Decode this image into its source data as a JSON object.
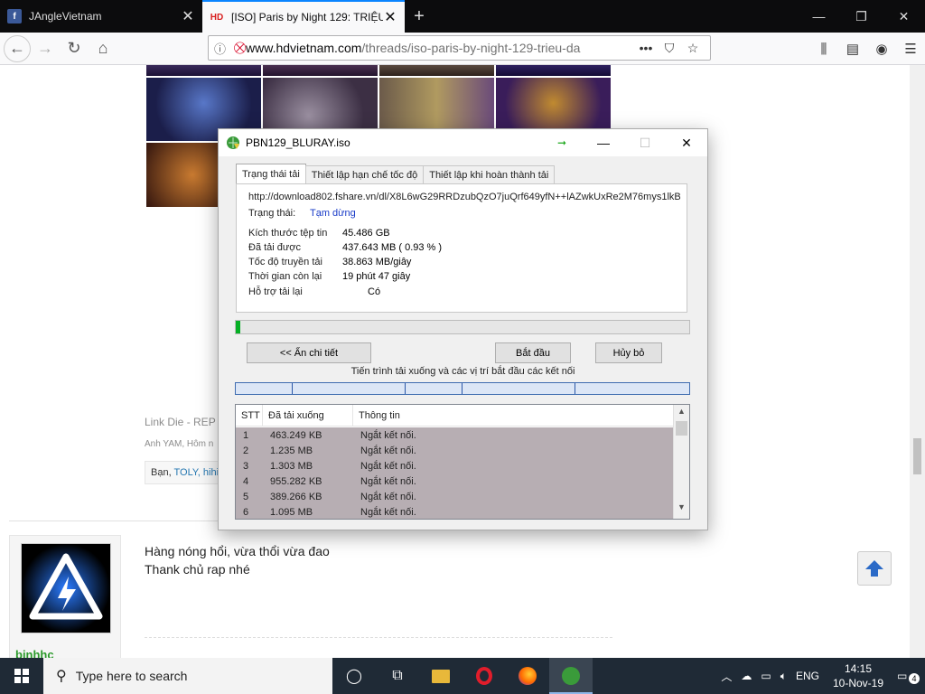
{
  "browser": {
    "tabs": [
      {
        "title": "JAngleVietnam",
        "favicon": "f",
        "active": false
      },
      {
        "title": "[ISO] Paris by Night 129: TRIỆU",
        "favicon": "HD",
        "active": true
      }
    ],
    "url_domain": "www.hdvietnam.com",
    "url_path": "/threads/iso-paris-by-night-129-trieu-da"
  },
  "page": {
    "link_die": "Link Die - REP",
    "anh_yam": "Anh YAM, Hôm n",
    "reactions_prefix": "Bạn, ",
    "reactions_names": "TOLY, hihi",
    "post_line1": "Hàng nóng hổi, vừa thổi vừa đao",
    "post_line2": "Thank chủ rap nhé",
    "username": "binhhc"
  },
  "dialog": {
    "title": "PBN129_BLURAY.iso",
    "tabs": [
      "Trạng thái tải",
      "Thiết lập hạn chế tốc độ",
      "Thiết lập khi hoàn thành tải"
    ],
    "url": "http://download802.fshare.vn/dl/X8L6wG29RRDzubQzO7juQrf649yfN++lAZwkUxRe2M76mys1lkB",
    "status_label": "Trạng thái:",
    "status_value": "Tạm dừng",
    "file_size_label": "Kích thước tệp tin",
    "file_size_value": "45.486  GB",
    "downloaded_label": "Đã tải được",
    "downloaded_value": "437.643  MB  ( 0.93 % )",
    "speed_label": "Tốc độ truyền tải",
    "speed_value": "38.863  MB/giây",
    "remaining_label": "Thời gian còn lại",
    "remaining_value": "19 phút 47 giây",
    "resume_label": "Hỗ trợ tải lại",
    "resume_value": "Có",
    "progress_percent": 0.93,
    "hide_details_button": "<< Ẩn chi tiết",
    "start_button": "Bắt đầu",
    "cancel_button": "Hủy bỏ",
    "segments_caption": "Tiến trình tải xuống và các vị trí bắt đầu các kết nối",
    "list_headers": [
      "STT",
      "Đã tải xuống",
      "Thông tin"
    ],
    "list_rows": [
      {
        "stt": "1",
        "downloaded": "463.249  KB",
        "info": "Ngắt kết nối."
      },
      {
        "stt": "2",
        "downloaded": "1.235  MB",
        "info": "Ngắt kết nối."
      },
      {
        "stt": "3",
        "downloaded": "1.303  MB",
        "info": "Ngắt kết nối."
      },
      {
        "stt": "4",
        "downloaded": "955.282  KB",
        "info": "Ngắt kết nối."
      },
      {
        "stt": "5",
        "downloaded": "389.266  KB",
        "info": "Ngắt kết nối."
      },
      {
        "stt": "6",
        "downloaded": "1.095  MB",
        "info": "Ngắt kết nối."
      }
    ]
  },
  "taskbar": {
    "search_placeholder": "Type here to search",
    "language": "ENG",
    "time": "14:15",
    "date": "10-Nov-19",
    "notifications": "4"
  }
}
